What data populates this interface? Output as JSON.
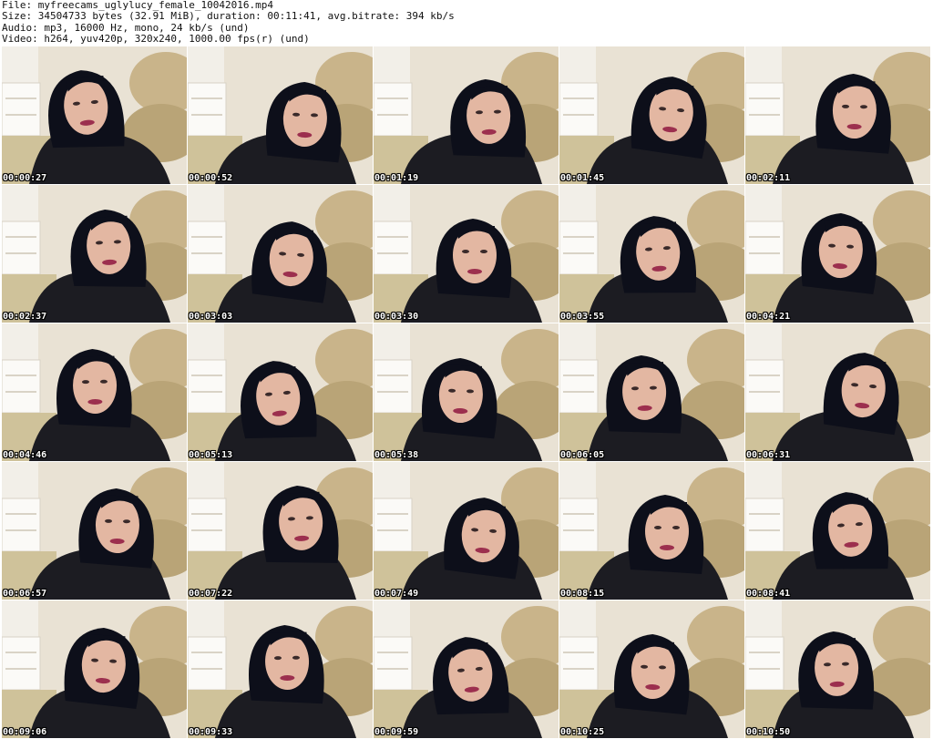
{
  "header": {
    "file_line": "File: myfreecams_uglylucy_female_10042016.mp4",
    "size_line": "Size: 34504733 bytes (32.91 MiB), duration: 00:11:41, avg.bitrate: 394 kb/s",
    "audio_line": "Audio: mp3, 16000 Hz, mono, 24 kb/s (und)",
    "video_line": "Video: h264, yuv420p, 320x240, 1000.00 fps(r) (und)"
  },
  "thumbnails": [
    {
      "timestamp": "00:00:27"
    },
    {
      "timestamp": "00:00:52"
    },
    {
      "timestamp": "00:01:19"
    },
    {
      "timestamp": "00:01:45"
    },
    {
      "timestamp": "00:02:11"
    },
    {
      "timestamp": "00:02:37"
    },
    {
      "timestamp": "00:03:03"
    },
    {
      "timestamp": "00:03:30"
    },
    {
      "timestamp": "00:03:55"
    },
    {
      "timestamp": "00:04:21"
    },
    {
      "timestamp": "00:04:46"
    },
    {
      "timestamp": "00:05:13"
    },
    {
      "timestamp": "00:05:38"
    },
    {
      "timestamp": "00:06:05"
    },
    {
      "timestamp": "00:06:31"
    },
    {
      "timestamp": "00:06:57"
    },
    {
      "timestamp": "00:07:22"
    },
    {
      "timestamp": "00:07:49"
    },
    {
      "timestamp": "00:08:15"
    },
    {
      "timestamp": "00:08:41"
    },
    {
      "timestamp": "00:09:06"
    },
    {
      "timestamp": "00:09:33"
    },
    {
      "timestamp": "00:09:59"
    },
    {
      "timestamp": "00:10:25"
    },
    {
      "timestamp": "00:10:50"
    }
  ],
  "colors": {
    "background": "#ffffff",
    "header_text": "#111111",
    "timestamp_text": "#ffffff",
    "timestamp_outline": "#000000",
    "wall": "#e9e2d4",
    "sofa": "#c9b48a",
    "sweater": "#1c1c22",
    "hair": "#0d0f1a",
    "skin": "#e3b7a2",
    "lips": "#9c2f4e"
  }
}
